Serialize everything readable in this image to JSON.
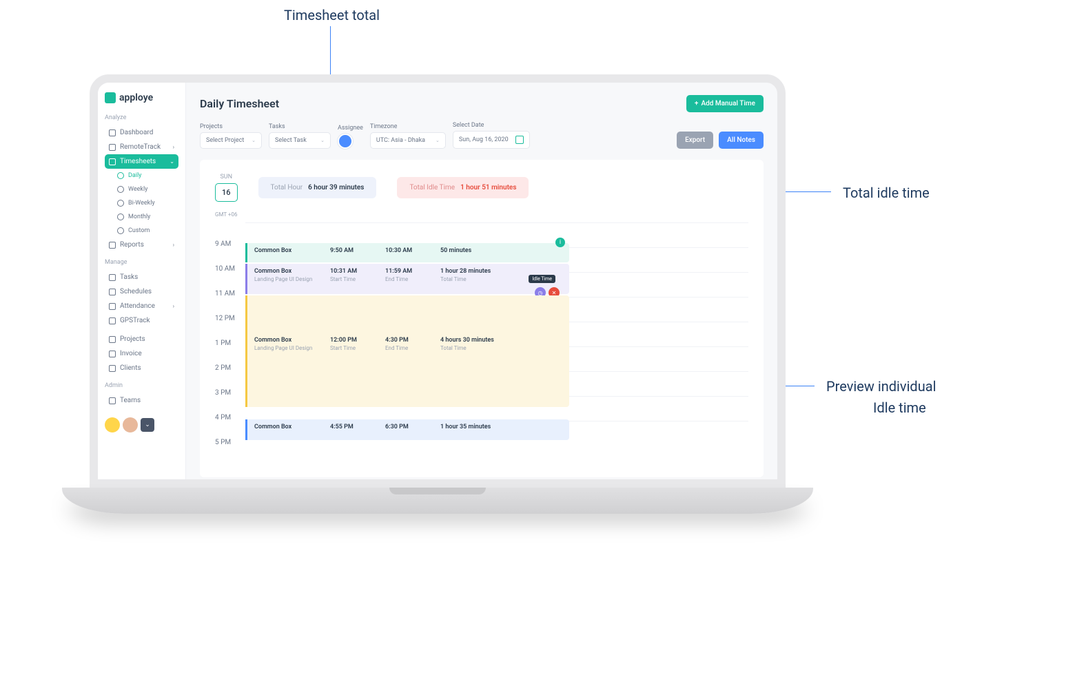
{
  "annotations": {
    "top": "Timesheet total",
    "right1": "Total idle time",
    "right2a": "Preview individual",
    "right2b": "Idle time"
  },
  "brand": "apploye",
  "sidebar": {
    "s1": "Analyze",
    "dashboard": "Dashboard",
    "remotetrack": "RemoteTrack",
    "timesheets": "Timesheets",
    "daily": "Daily",
    "weekly": "Weekly",
    "biweekly": "Bi-Weekly",
    "monthly": "Monthly",
    "custom": "Custom",
    "reports": "Reports",
    "s2": "Manage",
    "tasks": "Tasks",
    "schedules": "Schedules",
    "attendance": "Attendance",
    "gpstrack": "GPSTrack",
    "projects": "Projects",
    "invoice": "Invoice",
    "clients": "Clients",
    "s3": "Admin",
    "teams": "Teams"
  },
  "header": {
    "title": "Daily Timesheet",
    "add_manual": "Add Manual Time",
    "export": "Export",
    "all_notes": "All Notes"
  },
  "filters": {
    "projects_label": "Projects",
    "projects_value": "Select Project",
    "tasks_label": "Tasks",
    "tasks_value": "Select Task",
    "assignee_label": "Assignee",
    "timezone_label": "Timezone",
    "timezone_value": "UTC: Asia - Dhaka",
    "date_label": "Select Date",
    "date_value": "Sun, Aug 16, 2020"
  },
  "summary": {
    "day_name": "SUN",
    "day_num": "16",
    "total_hour_label": "Total Hour",
    "total_hour_value": "6 hour 39 minutes",
    "idle_label": "Total Idle Time",
    "idle_value": "1 hour 51 minutes"
  },
  "timeline": {
    "tz": "GMT +06",
    "hours": [
      "9 AM",
      "10 AM",
      "11 AM",
      "12 PM",
      "1 PM",
      "2 PM",
      "3 PM",
      "4 PM",
      "5 PM"
    ]
  },
  "events": {
    "e1": {
      "proj": "Common Box",
      "start": "9:50 AM",
      "end": "10:30 AM",
      "dur": "50 minutes"
    },
    "e2": {
      "proj": "Common Box",
      "task": "Landing Page UI Design",
      "start": "10:31 AM",
      "end": "11:59 AM",
      "dur": "1 hour 28 minutes",
      "st_lbl": "Start Time",
      "et_lbl": "End Time",
      "tt_lbl": "Total Time"
    },
    "e3": {
      "proj": "Common Box",
      "task": "Landing Page UI Design",
      "start": "12:00 PM",
      "end": "4:30 PM",
      "dur": "4 hours 30 minutes",
      "st_lbl": "Start Time",
      "et_lbl": "End Time",
      "tt_lbl": "Total Time"
    },
    "e4": {
      "proj": "Common Box",
      "start": "4:55 PM",
      "end": "6:30 PM",
      "dur": "1 hour 35 minutes"
    },
    "idle_tooltip": "Idle Time"
  }
}
